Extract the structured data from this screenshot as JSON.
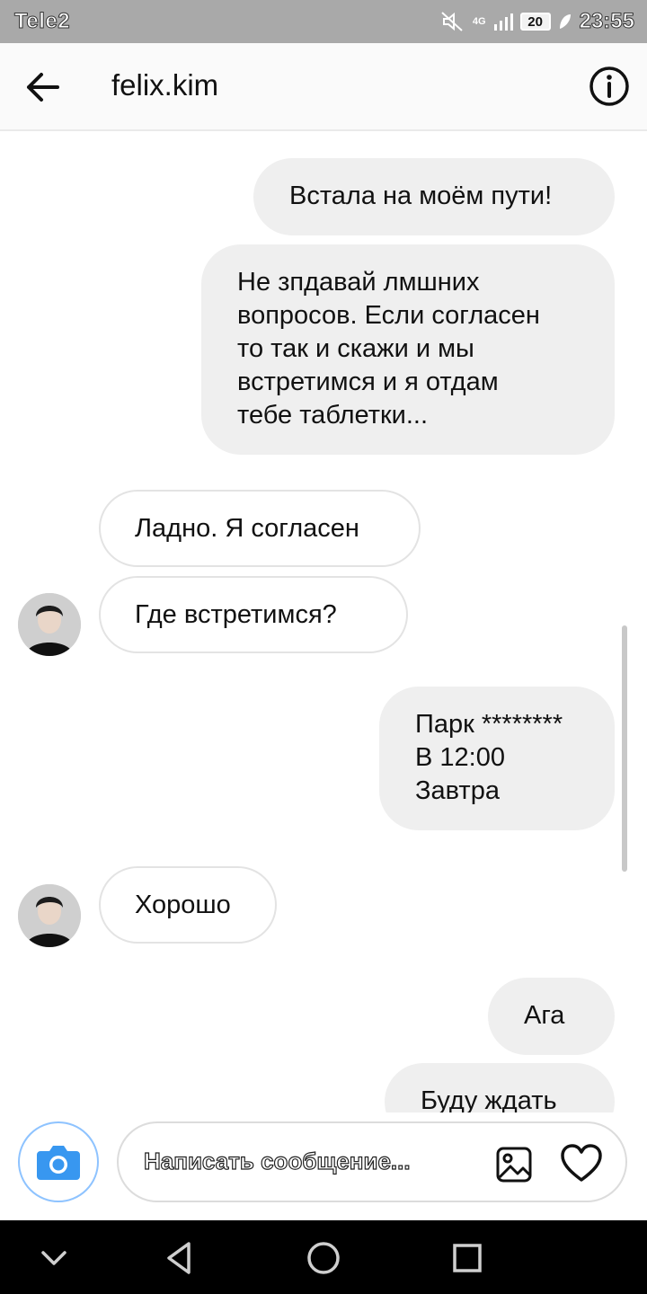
{
  "status_bar": {
    "carrier": "Tele2",
    "network": "4G",
    "battery": "20",
    "time": "23:55"
  },
  "header": {
    "title": "felix.kim",
    "back_icon": "arrow-left-icon",
    "info_icon": "info-icon"
  },
  "messages": [
    {
      "from": "me",
      "text": "Встала на моём пути!"
    },
    {
      "from": "me",
      "text": "Не зпдавай лмшних\nвопросов. Если согласен\nто так и скажи и мы\nвстретимся и я отдам\nтебе таблетки..."
    },
    {
      "from": "felix.kim",
      "text": "Ладно. Я согласен"
    },
    {
      "from": "felix.kim",
      "text": "Где встретимся?"
    },
    {
      "from": "me",
      "text": "Парк  ********\n   В 12:00\nЗавтра"
    },
    {
      "from": "felix.kim",
      "text": "Хорошо"
    },
    {
      "from": "me",
      "text": "Ага"
    },
    {
      "from": "me",
      "text": "Буду ждать"
    }
  ],
  "composer": {
    "placeholder": "Написать сообщение...",
    "camera_icon": "camera-icon",
    "gallery_icon": "image-icon",
    "like_icon": "heart-icon"
  },
  "nav_bar": {
    "icons": [
      "chevron-down-icon",
      "back-triangle-icon",
      "home-circle-icon",
      "recents-square-icon"
    ]
  },
  "colors": {
    "outgoing_bubble": "#efefef",
    "incoming_border": "#e3e3e3",
    "camera_accent": "#3897f0",
    "status_bar": "#a9a9a9"
  }
}
